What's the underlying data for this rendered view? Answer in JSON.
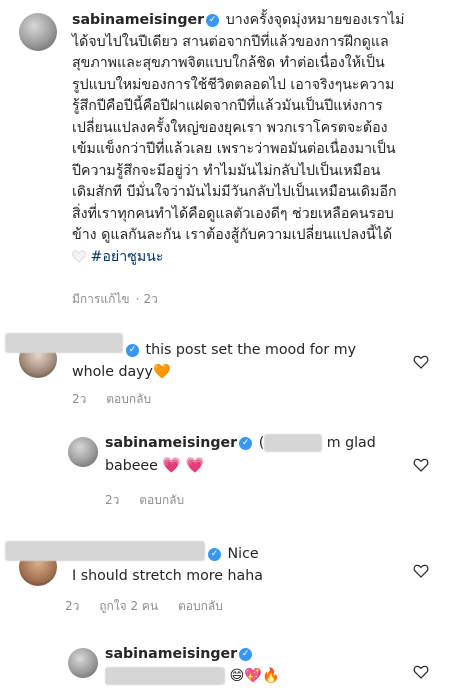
{
  "caption": {
    "username": "sabinameisinger",
    "lines": [
      "บางครั้งจุดมุ่งหมายของเราไม่",
      "ได้จบไปในปีเดียว สานต่อจากปีที่แล้วของการฝึกดูแล",
      "สุขภาพและสุขภาพจิตแบบใกล้ชิด ทำต่อเนื่องให้เป็น",
      "รูปแบบใหม่ของการใช้ชีวิตตลอดไป เอาจริงๆนะความ",
      "รู้สึกปีคือปีนี้คือปีฝาแฝดจากปีที่แล้วมันเป็นปีแห่งการ",
      "เปลี่ยนแปลงครั้งใหญ่ของยุคเรา พวกเราโครตจะต้อง",
      "เข้มแข็งกว่าปีที่แล้วเลย เพราะว่าพอมันต่อเนื่องมาเป็น",
      "ปีความรู้สึกจะมีอยู่ว่า ทำไมมันไม่กลับไปเป็นเหมือน",
      "เดิมสักที บีมั่นใจว่ามันไม่มีวันกลับไปเป็นเหมือนเดิมอีก",
      "สิ่งที่เราทุกคนทำได้คือดูแลตัวเองดีๆ ช่วยเหลือคนรอบ",
      "ข้าง ดูแลกันละกัน เราต้องสู้กับความเปลี่ยนแปลงนี้ได้"
    ],
    "hashtag": "#อย่าซูมนะ",
    "edited": "มีการแก้ไข",
    "time": "2ว"
  },
  "comments": [
    {
      "text1": "this post set the mood for my",
      "text2": "whole dayy",
      "emoji": "🧡",
      "time": "2ว",
      "reply": "ตอบกลับ"
    },
    {
      "username": "sabinameisinger",
      "text_prefix": "(",
      "text1": "m glad",
      "text2": "babeee",
      "emoji": "💗 💗",
      "time": "2ว",
      "reply": "ตอบกลับ"
    },
    {
      "text1": "Nice",
      "text2": "I should stretch more haha",
      "time": "2ว",
      "likes": "ถูกใจ 2 คน",
      "reply": "ตอบกลับ"
    },
    {
      "username": "sabinameisinger",
      "emoji": "😄💖🔥"
    }
  ],
  "colors": {
    "verified": "#3897f0",
    "muted": "#8e8e8e",
    "link": "#003569"
  }
}
